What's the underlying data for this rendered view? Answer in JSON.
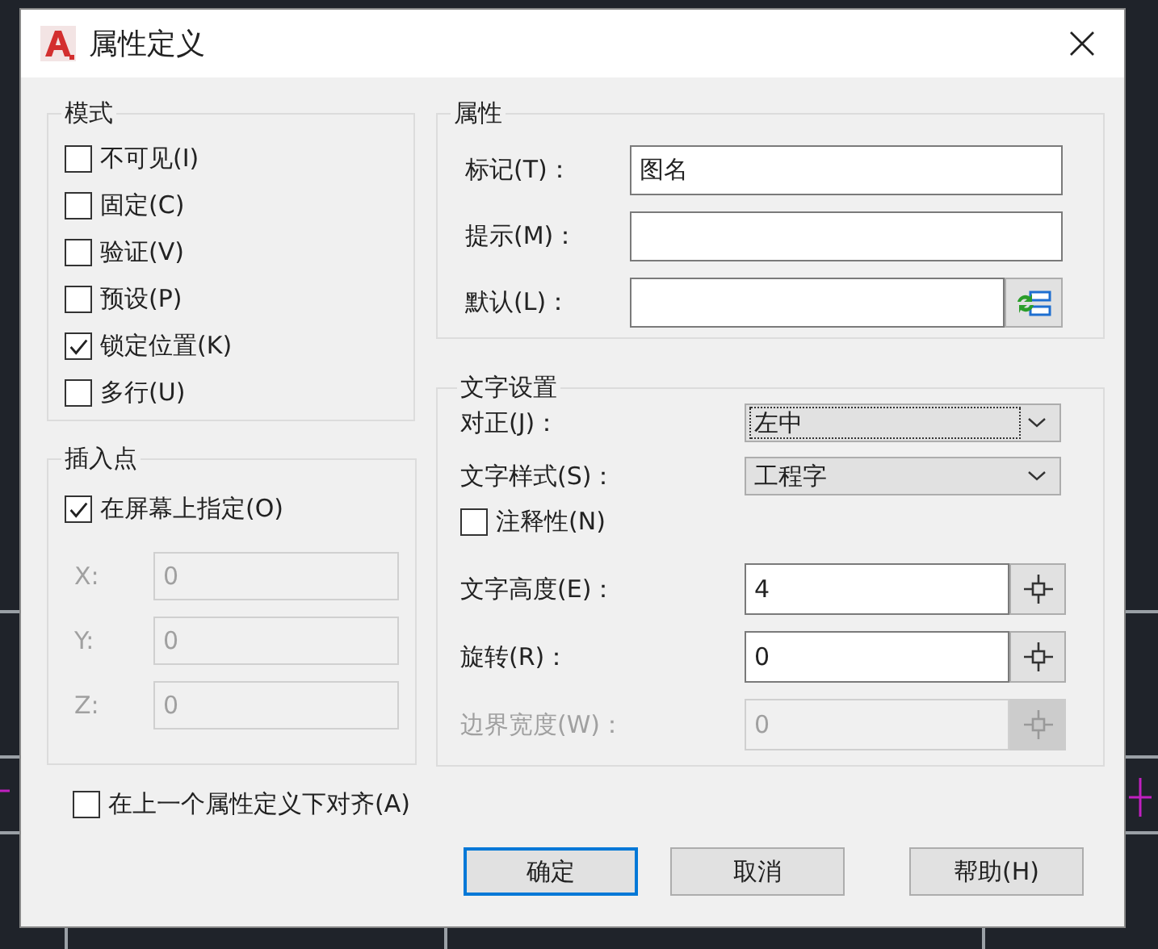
{
  "window": {
    "title": "属性定义"
  },
  "mode": {
    "title": "模式",
    "options": [
      {
        "label": "不可见(I)",
        "checked": false
      },
      {
        "label": "固定(C)",
        "checked": false
      },
      {
        "label": "验证(V)",
        "checked": false
      },
      {
        "label": "预设(P)",
        "checked": false
      },
      {
        "label": "锁定位置(K)",
        "checked": true
      },
      {
        "label": "多行(U)",
        "checked": false
      }
    ]
  },
  "insertion_point": {
    "title": "插入点",
    "on_screen": {
      "label": "在屏幕上指定(O)",
      "checked": true
    },
    "coords": [
      {
        "label": "X:",
        "value": "0",
        "disabled": true
      },
      {
        "label": "Y:",
        "value": "0",
        "disabled": true
      },
      {
        "label": "Z:",
        "value": "0",
        "disabled": true
      }
    ]
  },
  "attribute": {
    "title": "属性",
    "fields": [
      {
        "kind": "text",
        "label": "标记(T)：",
        "value": "图名"
      },
      {
        "kind": "text",
        "label": "提示(M)："
      },
      {
        "kind": "field_button",
        "label": "默认(L)："
      }
    ]
  },
  "text_settings": {
    "title": "文字设置",
    "rows": [
      {
        "kind": "select",
        "label": "对正(J)：",
        "value": "左中",
        "focused": true
      },
      {
        "kind": "select",
        "label": "文字样式(S)：",
        "value": "工程字",
        "focused": false
      },
      {
        "kind": "checkbox",
        "label": "注释性(N)",
        "checked": false
      },
      {
        "kind": "pick",
        "label": "文字高度(E)：",
        "value": "4",
        "disabled": false
      },
      {
        "kind": "pick",
        "label": "旋转(R)：",
        "value": "0",
        "disabled": false
      },
      {
        "kind": "pick",
        "label": "边界宽度(W)：",
        "value": "0",
        "disabled": true
      }
    ]
  },
  "align_below": {
    "label": "在上一个属性定义下对齐(A)",
    "checked": false
  },
  "buttons": [
    {
      "label": "确定",
      "default": true
    },
    {
      "label": "取消",
      "default": false
    },
    {
      "label": "帮助(H)",
      "default": false
    }
  ]
}
